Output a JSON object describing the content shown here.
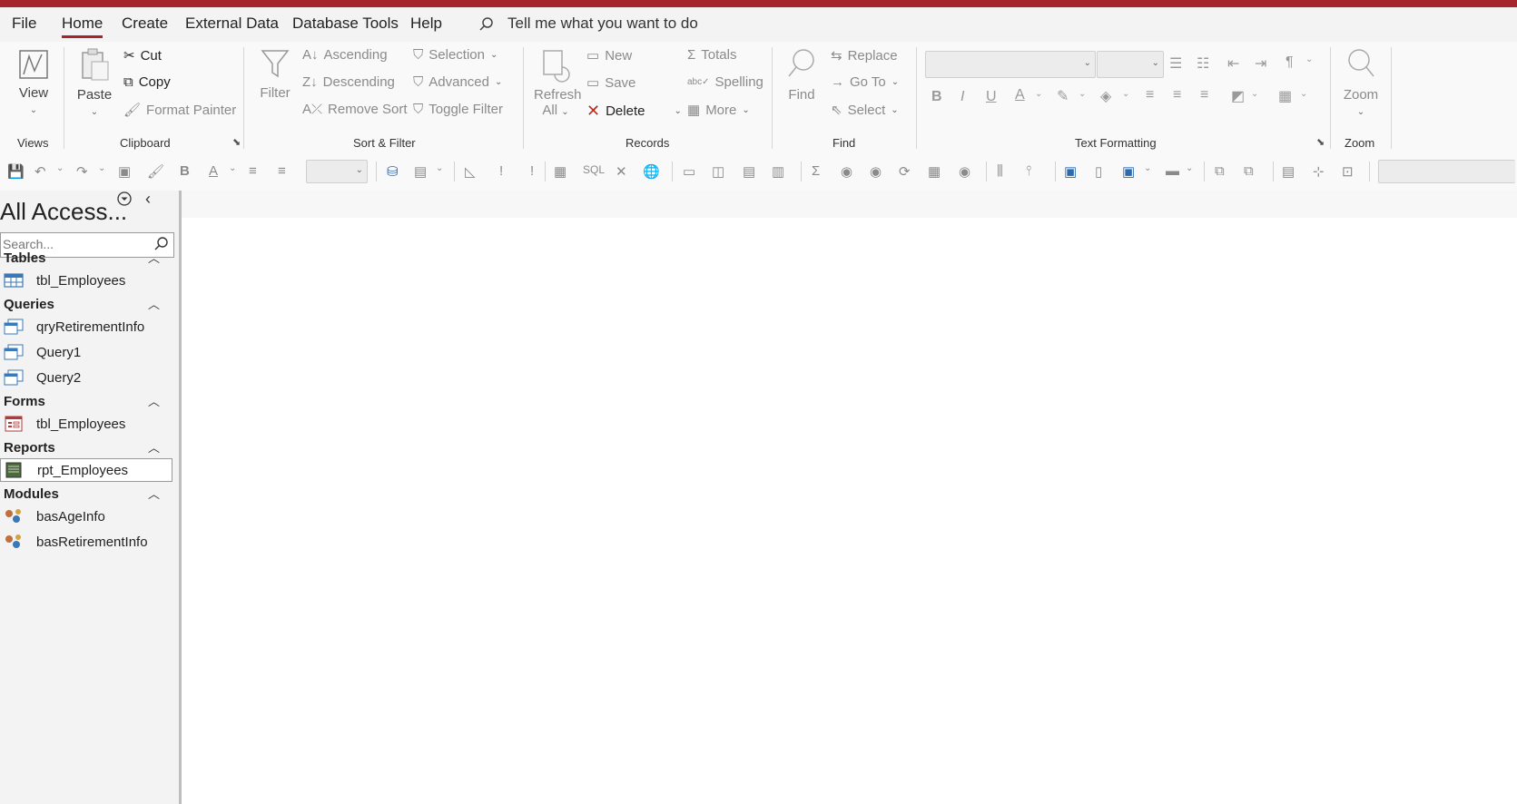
{
  "menubar": {
    "tabs": [
      "File",
      "Home",
      "Create",
      "External Data",
      "Database Tools",
      "Help"
    ],
    "active": "Home",
    "tellme": "Tell me what you want to do"
  },
  "ribbon": {
    "views": {
      "view_label": "View",
      "group": "Views"
    },
    "clipboard": {
      "paste": "Paste",
      "cut": "Cut",
      "copy": "Copy",
      "format_painter": "Format Painter",
      "group": "Clipboard"
    },
    "sortfilter": {
      "filter": "Filter",
      "ascending": "Ascending",
      "descending": "Descending",
      "remove_sort": "Remove Sort",
      "selection": "Selection",
      "advanced": "Advanced",
      "toggle_filter": "Toggle Filter",
      "group": "Sort & Filter"
    },
    "records": {
      "refresh": "Refresh",
      "refresh_sub": "All",
      "new": "New",
      "save": "Save",
      "delete": "Delete",
      "totals": "Totals",
      "spelling": "Spelling",
      "more": "More",
      "group": "Records"
    },
    "find": {
      "find": "Find",
      "replace": "Replace",
      "goto": "Go To",
      "select": "Select",
      "group": "Find"
    },
    "textfmt": {
      "group": "Text Formatting"
    },
    "zoom": {
      "zoom": "Zoom",
      "group": "Zoom"
    }
  },
  "qat": {
    "bold": "B",
    "sql": "SQL"
  },
  "nav": {
    "title": "All Access...",
    "search_placeholder": "Search...",
    "categories": {
      "tables": {
        "label": "Tables",
        "items": [
          "tbl_Employees"
        ]
      },
      "queries": {
        "label": "Queries",
        "items": [
          "qryRetirementInfo",
          "Query1",
          "Query2"
        ]
      },
      "forms": {
        "label": "Forms",
        "items": [
          "tbl_Employees"
        ]
      },
      "reports": {
        "label": "Reports",
        "items": [
          "rpt_Employees"
        ]
      },
      "modules": {
        "label": "Modules",
        "items": [
          "basAgeInfo",
          "basRetirementInfo"
        ]
      }
    }
  },
  "colors": {
    "accent": "#a4262c",
    "delete": "#c42b1c"
  }
}
